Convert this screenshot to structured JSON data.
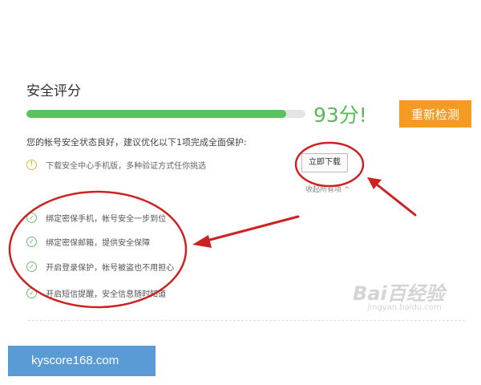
{
  "panel": {
    "title": "安全评分",
    "score_text": "93分!",
    "score_progress": 0.93,
    "recheck_label": "重新检测",
    "summary": "您的帐号安全状态良好，建议优化以下1项完成全面保护:",
    "tip": {
      "icon": "warning-circle-icon",
      "text": "下载安全中心手机版，多种验证方式任你挑选",
      "action_label": "立即下载"
    },
    "collapse_label": "收起所有项 ^",
    "items": [
      {
        "icon": "check-icon",
        "text": "绑定密保手机，帐号安全一步到位"
      },
      {
        "icon": "check-icon",
        "text": "绑定密保邮箱，提供安全保障"
      },
      {
        "icon": "check-icon",
        "text": "开启登录保护，帐号被盗也不用担心"
      },
      {
        "icon": "check-icon",
        "text": "开启短信提醒，安全信息随时知道"
      }
    ]
  },
  "watermark": {
    "logo": "Bai百经验",
    "sub": "jingyan.baidu.com"
  },
  "site_banner": "kyscore168.com",
  "colors": {
    "accent_orange": "#f59a23",
    "progress_green": "#5cc05c",
    "annotation_red": "#cc2222"
  }
}
